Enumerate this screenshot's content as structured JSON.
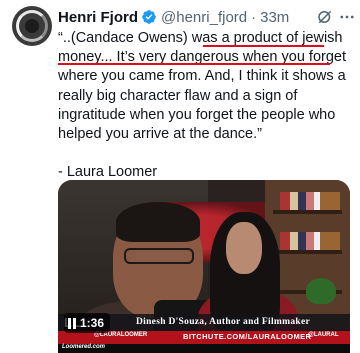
{
  "author": {
    "display_name": "Henri Fjord",
    "handle": "@henri_fjord",
    "separator": "·",
    "time": "33m",
    "verified": true
  },
  "tweet": {
    "text_lines": [
      "“..(Candace Owens) was a product of jewish",
      "money... It’s very dangerous when you forget",
      "where you came from. And, I think it shows a",
      "really big character flaw and a sign of",
      "ingratitude when you forget the people who",
      "helped you arrive at the dance.”",
      "- Laura Loomer"
    ],
    "highlight_color": "#d80f1e"
  },
  "icons": {
    "grok": "grok-icon",
    "more": "more-horizontal-icon",
    "verified": "verified-badge-icon",
    "pause": "pause-icon"
  },
  "video": {
    "duration": "1:36",
    "lower_third": {
      "logo": "LL",
      "name_title": "Dinesh D'Souza, Author and Filmmaker",
      "handle": "@LAURALOOMER",
      "url": "BITCHUTE.COM/LAURALOOMER",
      "right": "@LAURAL",
      "brand": "Loomered.com"
    }
  },
  "colors": {
    "accent": "#1d9bf0",
    "text": "#0f1419",
    "secondary": "#536471",
    "banner_red": "#b3121d"
  }
}
